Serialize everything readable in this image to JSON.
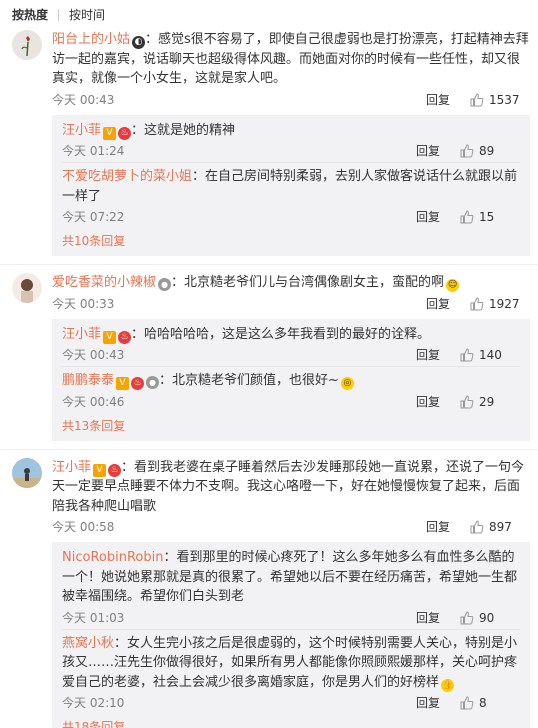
{
  "tabs": {
    "hot": "按热度",
    "time": "按时间"
  },
  "reply_label": "回复",
  "comments": [
    {
      "user": "阳台上的小姑",
      "text": "：感觉s很不容易了，即使自己很虚弱也是打扮漂亮，打起精神去拜访一起的嘉宾，说话聊天也超级得体风趣。而她面对你的时候有一些任性，却又很真实，就像一个小女生，这就是家人吧。",
      "time": "今天 00:43",
      "likes": "1537",
      "subs": [
        {
          "user": "汪小菲",
          "text": "：这就是她的精神",
          "time": "今天 01:24",
          "likes": "89"
        },
        {
          "user": "不爱吃胡萝卜的菜小姐",
          "text": "：在自己房间特别柔弱，去别人家做客说话什么就跟以前一样了",
          "time": "今天 07:22",
          "likes": "15"
        }
      ],
      "more": "共10条回复"
    },
    {
      "user": "爱吃香菜的小辣椒",
      "text": "：北京糙老爷们儿与台湾偶像剧女主，蛮配的啊",
      "time": "今天 00:33",
      "likes": "1927",
      "subs": [
        {
          "user": "汪小菲",
          "text": "：哈哈哈哈哈，这是这么多年我看到的最好的诠释。",
          "time": "今天 00:43",
          "likes": "140"
        },
        {
          "user": "鹏鹏泰泰",
          "text": "：北京糙老爷们颜值，也很好~",
          "time": "今天 00:46",
          "likes": "29"
        }
      ],
      "more": "共13条回复"
    },
    {
      "user": "汪小菲",
      "text": "：看到我老婆在桌子睡着然后去沙发睡那段她一直说累，还说了一句今天一定要早点睡要不体力不支啊。我这心咯噔一下，好在她慢慢恢复了起来，后面陪我各种爬山唱歌",
      "time": "今天 00:58",
      "likes": "897",
      "subs": [
        {
          "user": "NicoRobinRobin",
          "text": "：看到那里的时候心疼死了！这么多年她多么有血性多么酷的一个！她说她累那就是真的很累了。希望她以后不要在经历痛苦，希望她一生都被幸福围绕。希望你们白头到老",
          "time": "今天 01:03",
          "likes": "90"
        },
        {
          "user": "燕窝小秋",
          "text": "：女人生完小孩之后是很虚弱的，这个时候特别需要人关心，特别是小孩又……汪先生你做得很好，如果所有男人都能像你照顾熙媛那样，关心呵护疼爱自己的老婆，社会上会减少很多离婚家庭，你是男人们的好榜样",
          "time": "今天 02:10",
          "likes": "8"
        }
      ],
      "more": "共18条回复"
    }
  ]
}
